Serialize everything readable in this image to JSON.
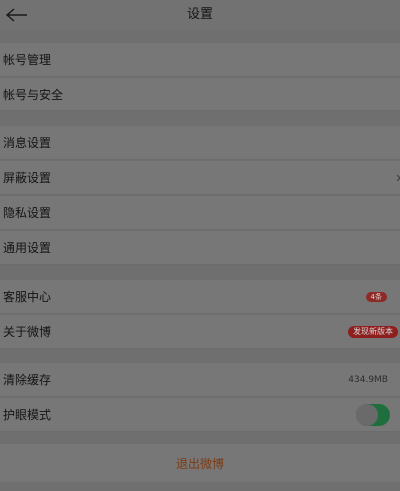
{
  "header": {
    "title": "设置"
  },
  "sections": {
    "account": {
      "account_management": "帐号管理",
      "account_security": "帐号与安全"
    },
    "settings": {
      "message": "消息设置",
      "shield": "屏蔽设置",
      "privacy": "隐私设置",
      "general": "通用设置"
    },
    "support": {
      "customer_service": "客服中心",
      "customer_service_badge": "4条",
      "about": "关于微博",
      "about_badge": "发现新版本"
    },
    "storage": {
      "clear_cache": "清除缓存",
      "cache_size": "434.9MB",
      "eye_mode": "护眼模式",
      "eye_mode_on": true
    }
  },
  "logout": {
    "label": "退出微博"
  },
  "colors": {
    "accent_red": "#8f1f1f",
    "toggle_green": "#1f6f3e",
    "logout_text": "#7c3a12"
  }
}
